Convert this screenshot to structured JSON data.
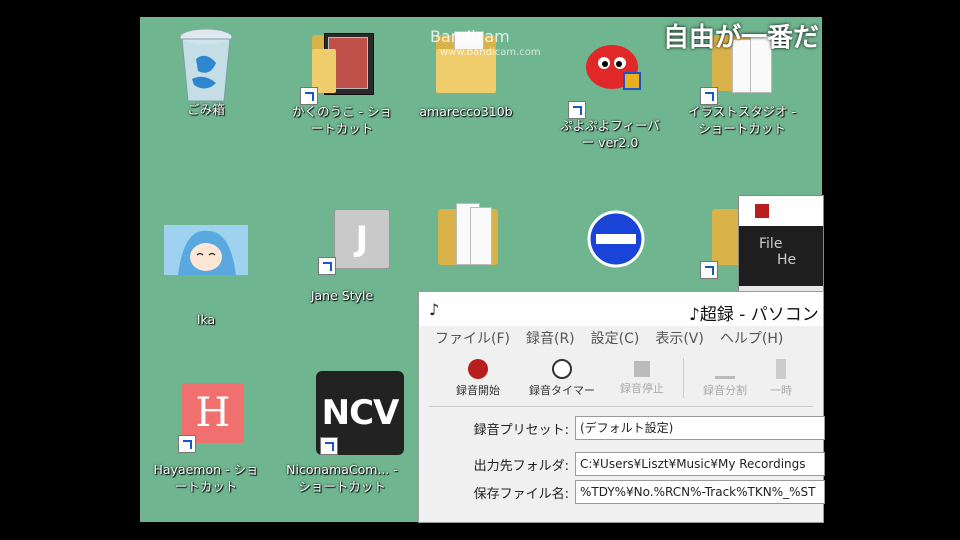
{
  "overlay": {
    "caption": "自由が一番だ",
    "watermark": "Bandicam",
    "watermark_sub": "www.bandicam.com"
  },
  "icons": {
    "recycle": "ごみ箱",
    "kakunouko": "かくのうこ - ショートカット",
    "amarecco": "amarecco310b",
    "puyo": "ぷよぷよフィーバー ver2.0",
    "illust": "イラストスタジオ - ショートカット",
    "ika": "Ika",
    "jane": "Jane Style",
    "hayaemon": "Hayaemon - ショートカット",
    "ncv": "NiconamaCom... - ショートカット",
    "ncv_badge": "NCV",
    "jane_glyph": "J",
    "hayaemon_glyph": "H"
  },
  "terminal": {
    "menu_file": "File",
    "menu_help": "He"
  },
  "recorder": {
    "title": "♪超録 - パソコン",
    "menus": [
      "ファイル(F)",
      "録音(R)",
      "設定(C)",
      "表示(V)",
      "ヘルプ(H)"
    ],
    "toolbar": {
      "start": "録音開始",
      "timer": "録音タイマー",
      "stop": "録音停止",
      "split": "録音分割",
      "pause": "一時"
    },
    "preset_label": "録音プリセット:",
    "preset_value": "(デフォルト設定)",
    "folder_label": "出力先フォルダ:",
    "folder_value": "C:¥Users¥Liszt¥Music¥My Recordings",
    "filename_label": "保存ファイル名:",
    "filename_value": "%TDY%¥No.%RCN%-Track%TKN%_%ST"
  },
  "colors": {
    "desktop": "#6fb58f",
    "accent_blue": "#1a56c8",
    "record_red": "#b81e1e"
  }
}
